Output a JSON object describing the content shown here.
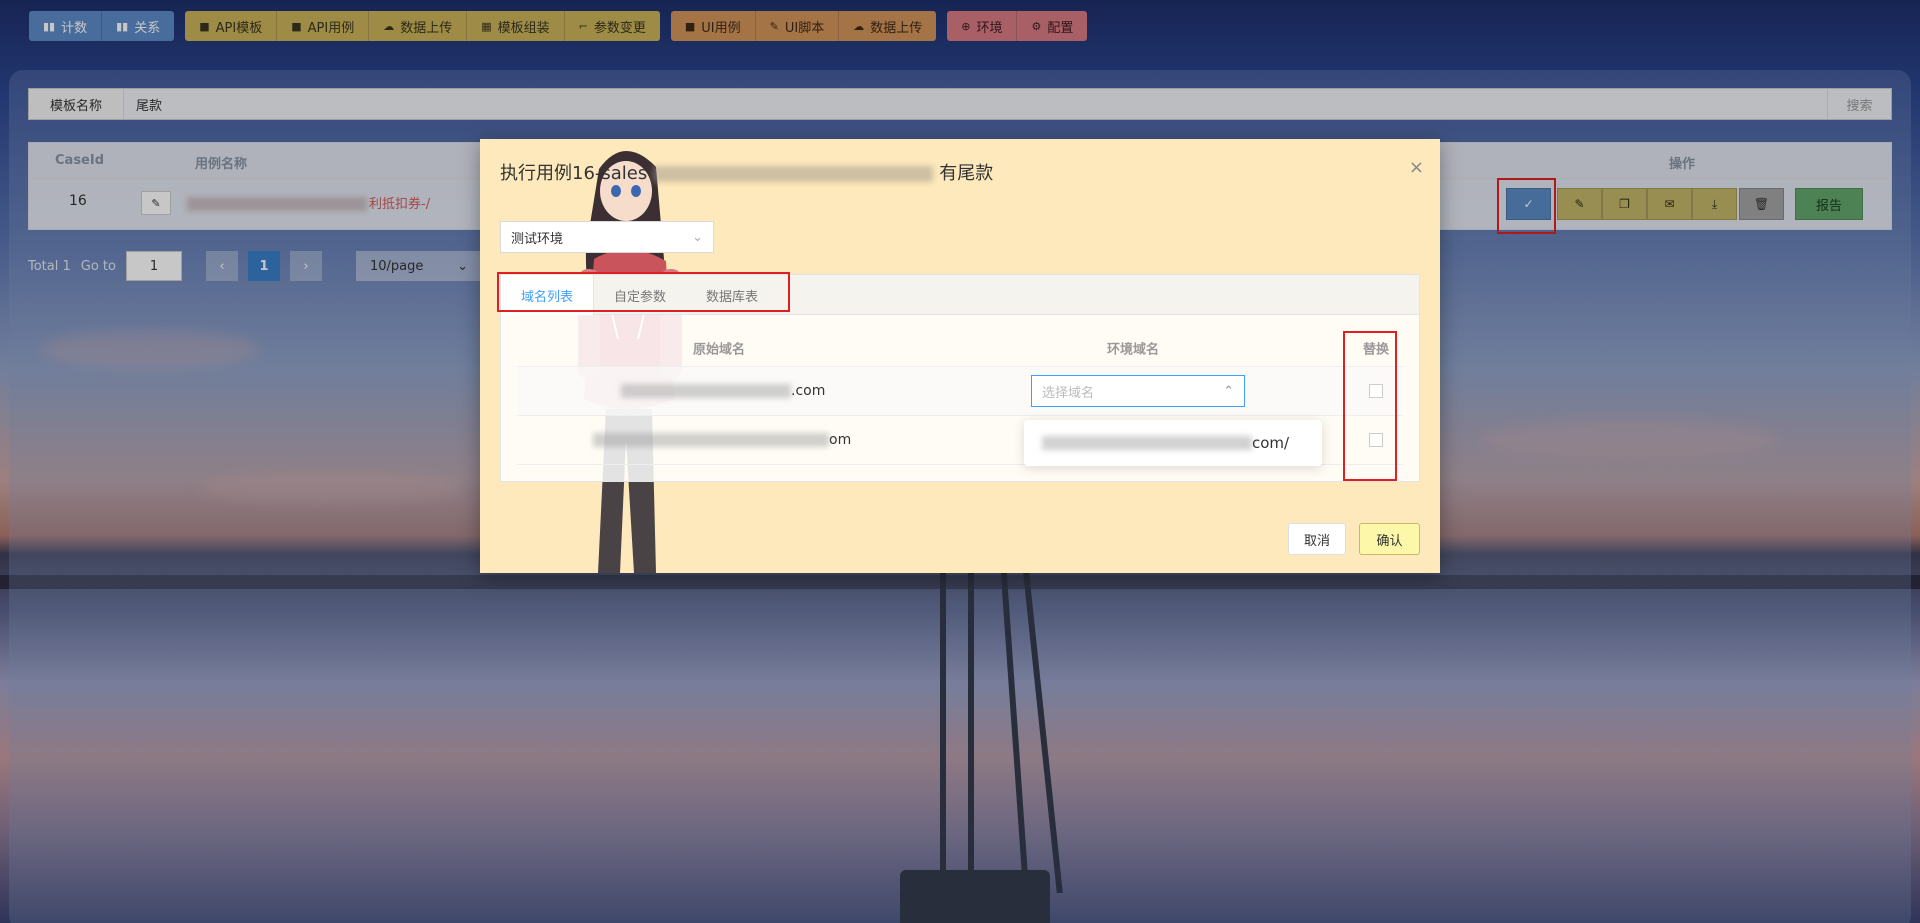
{
  "topnav": {
    "group1": [
      {
        "label": "计数",
        "icon": "bar-chart-icon"
      },
      {
        "label": "关系",
        "icon": "bar-chart-icon"
      }
    ],
    "group2": [
      {
        "label": "API模板",
        "icon": "clipboard-icon"
      },
      {
        "label": "API用例",
        "icon": "clipboard-icon"
      },
      {
        "label": "数据上传",
        "icon": "cloud-upload-icon"
      },
      {
        "label": "模板组装",
        "icon": "grid-icon"
      },
      {
        "label": "参数变更",
        "icon": "crop-icon"
      }
    ],
    "group3": [
      {
        "label": "UI用例",
        "icon": "clipboard-icon"
      },
      {
        "label": "UI脚本",
        "icon": "edit-icon"
      },
      {
        "label": "数据上传",
        "icon": "cloud-upload-icon"
      }
    ],
    "group4": [
      {
        "label": "环境",
        "icon": "plus-circle-icon"
      },
      {
        "label": "配置",
        "icon": "gear-icon"
      }
    ]
  },
  "search": {
    "label": "模板名称",
    "value": "尾款",
    "button": "搜索"
  },
  "table": {
    "headers": {
      "case_id": "CaseId",
      "case_name": "用例名称",
      "ops": "操作"
    },
    "row": {
      "id": "16",
      "name_visible": "利抵扣券-/"
    },
    "report_label": "报告"
  },
  "pager": {
    "total": "Total 1",
    "goto": "Go to",
    "goto_value": "1",
    "page": "1",
    "page_size": "10/page",
    "prev": "‹",
    "next": "›"
  },
  "modal": {
    "title_prefix": "执行用例16-sales",
    "title_suffix": "有尾款",
    "env_select": "测试环境",
    "tabs": [
      "域名列表",
      "自定参数",
      "数据库表"
    ],
    "columns": {
      "original": "原始域名",
      "env": "环境域名",
      "replace": "替换"
    },
    "rows": [
      {
        "original_suffix": ".com",
        "env_placeholder": "选择域名"
      },
      {
        "original_suffix": "om",
        "env_placeholder": ""
      }
    ],
    "dropdown_option_suffix": "com/",
    "cancel": "取消",
    "confirm": "确认",
    "close": "×"
  },
  "colors": {
    "primary": "#409eff",
    "modal_bg": "#fde9bb",
    "highlight": "#e02020"
  }
}
